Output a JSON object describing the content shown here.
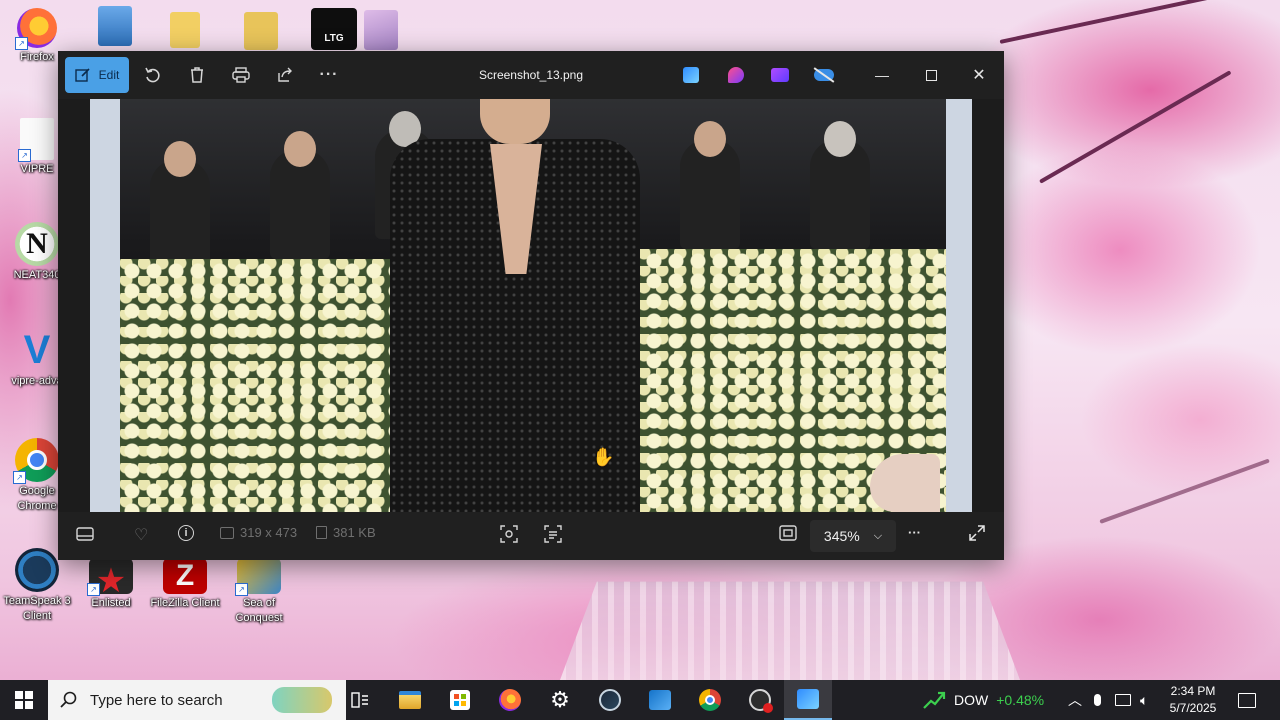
{
  "desktop": {
    "icons": [
      {
        "label": "Firefox",
        "icon": "firefox-icon"
      },
      {
        "label": "VIPRE",
        "icon": "file-icon"
      },
      {
        "label": "NEAT340",
        "icon": "neat-icon"
      },
      {
        "label": "vipre-adva",
        "icon": "vipre-icon"
      },
      {
        "label": "Google Chrome",
        "icon": "chrome-icon"
      },
      {
        "label": "TeamSpeak 3 Client",
        "icon": "teamspeak-icon"
      },
      {
        "label": "Enlisted",
        "icon": "enlisted-icon"
      },
      {
        "label": "FileZilla Client",
        "icon": "filezilla-icon"
      },
      {
        "label": "Sea of Conquest",
        "icon": "sea-of-conquest-icon"
      }
    ],
    "top_icons": [
      "installer-icon",
      "folder-icon",
      "video-folder-icon",
      "ltg-icon",
      "wallpaper-icon"
    ],
    "ltg_text": "LTG"
  },
  "photos_window": {
    "title": "Screenshot_13.png",
    "edit_label": "Edit",
    "toolbar_icons": [
      "rotate-icon",
      "delete-icon",
      "print-icon",
      "share-icon",
      "more-icon"
    ],
    "app_icons": [
      "designer-icon",
      "clipchamp-icon",
      "video-editor-icon",
      "onedrive-icon"
    ],
    "more_glyph": "···",
    "dimensions": "319 x 473",
    "file_size": "381 KB",
    "zoom": "345%",
    "bottom_icons": [
      "filmstrip-icon",
      "favorite-icon",
      "info-icon",
      "visual-search-icon",
      "text-scan-icon",
      "fit-window-icon",
      "fullscreen-icon"
    ]
  },
  "taskbar": {
    "search_placeholder": "Type here to search",
    "apps": [
      "copilot-icon",
      "task-view-icon",
      "file-explorer-icon",
      "store-icon",
      "firefox-icon",
      "settings-icon",
      "steam-icon",
      "clipchamp-icon",
      "chrome-icon",
      "obs-icon",
      "photos-icon"
    ],
    "stock_name": "DOW",
    "stock_change": "+0.48%",
    "time": "2:34 PM",
    "date": "5/7/2025"
  },
  "colors": {
    "accent": "#4aa0e6",
    "stock_up": "#3ccf4e",
    "taskbar": "#1f1f24",
    "window": "#202020"
  }
}
